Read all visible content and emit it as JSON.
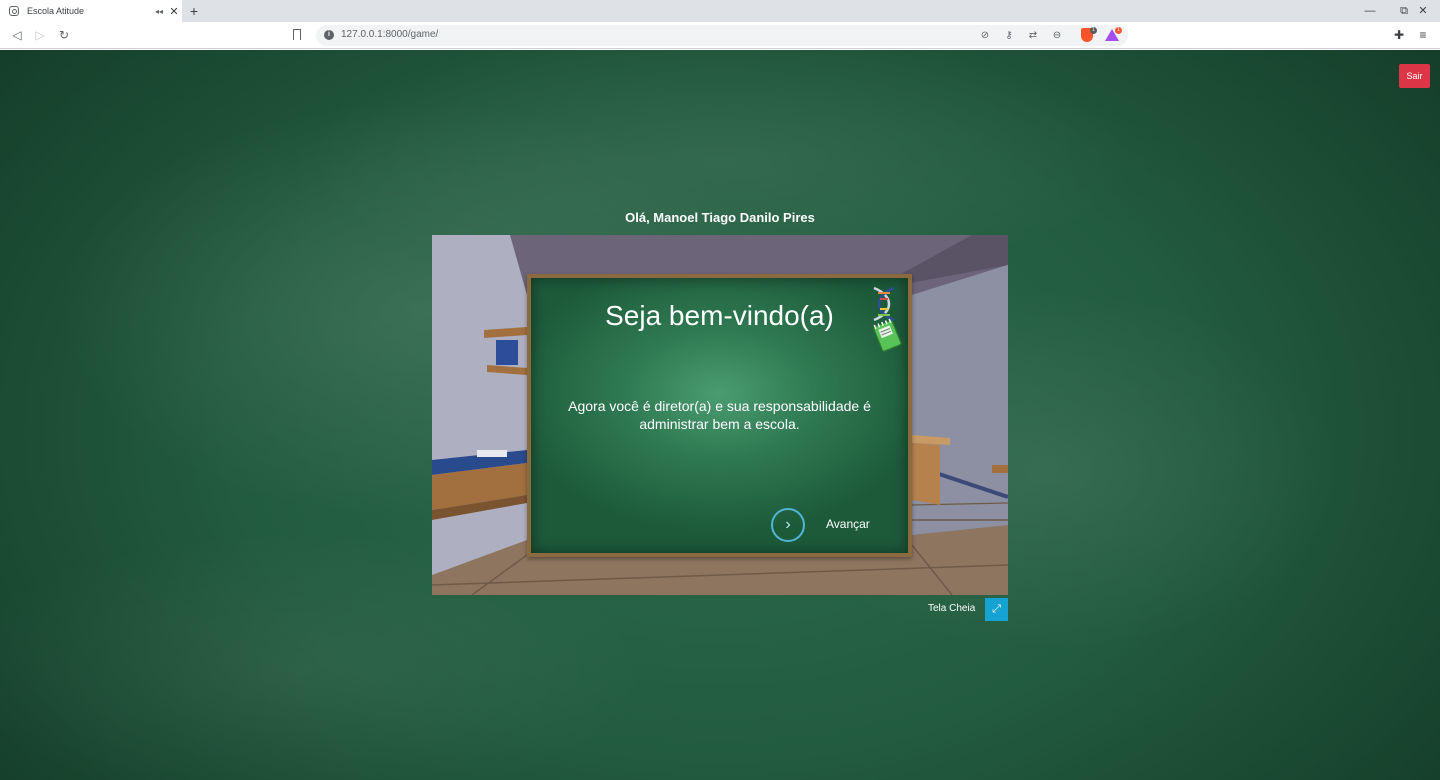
{
  "browser": {
    "tab_title": "Escola Atitude",
    "audio_icon": "◂◂",
    "close_icon": "✕",
    "new_tab_icon": "+",
    "url": "127.0.0.1:8000/game/",
    "window_controls": {
      "minimize": "—",
      "restore": "⧉",
      "close": "✕"
    },
    "nav": {
      "back": "◁",
      "forward": "▷",
      "reload": "↻"
    },
    "rewards_badge": "1",
    "shield_badge": "1"
  },
  "page": {
    "logout_label": "Sair",
    "greeting": "Olá, Manoel Tiago Danilo Pires"
  },
  "game": {
    "title": "Seja bem-vindo(a)",
    "message": "Agora você é diretor(a) e sua responsabilidade é administrar bem a escola.",
    "next_icon": "›",
    "next_label": "Avançar"
  },
  "fullscreen": {
    "label": "Tela Cheia",
    "icon": "⤢"
  },
  "colors": {
    "chalkboard_bg": "#225b3e",
    "logout": "#dc3545",
    "fullscreen": "#17a2d4",
    "next_ring": "#4fb6d6"
  }
}
